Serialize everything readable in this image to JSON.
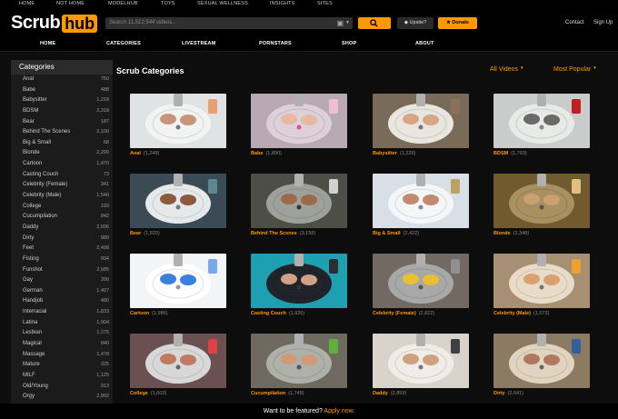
{
  "top_nav": [
    "HOME",
    "NOT HOME",
    "MODELHUB",
    "TOYS",
    "SEXUAL WELLNESS",
    "INSIGHTS",
    "SITES"
  ],
  "logo": {
    "part1": "Scrub",
    "part2": "hub"
  },
  "search": {
    "placeholder": "Search 11,512,544 videos..."
  },
  "header": {
    "upsell": "Upsite?",
    "donate": "Donate",
    "contact": "Contact",
    "signup": "Sign Up"
  },
  "main_nav": [
    "HOME",
    "CATEGORIES",
    "LIVESTREAM",
    "PORNSTARS",
    "SHOP",
    "ABOUT"
  ],
  "sidebar": {
    "title": "Categories",
    "items": [
      {
        "label": "Anal",
        "count": "750"
      },
      {
        "label": "Babe",
        "count": "488"
      },
      {
        "label": "Babysitter",
        "count": "1,218"
      },
      {
        "label": "BDSM",
        "count": "2,318"
      },
      {
        "label": "Bear",
        "count": "187"
      },
      {
        "label": "Behind The Scenes",
        "count": "2,100"
      },
      {
        "label": "Big & Small",
        "count": "68"
      },
      {
        "label": "Blonde",
        "count": "2,290"
      },
      {
        "label": "Cartoon",
        "count": "1,470"
      },
      {
        "label": "Casting Couch",
        "count": "73"
      },
      {
        "label": "Celebrity (Female)",
        "count": "341"
      },
      {
        "label": "Celebrity (Male)",
        "count": "1,540"
      },
      {
        "label": "College",
        "count": "193"
      },
      {
        "label": "Cucumpilation",
        "count": "842"
      },
      {
        "label": "Daddy",
        "count": "2,696"
      },
      {
        "label": "Dirty",
        "count": "989"
      },
      {
        "label": "Feet",
        "count": "2,498"
      },
      {
        "label": "Fisting",
        "count": "994"
      },
      {
        "label": "Funshot",
        "count": "2,685"
      },
      {
        "label": "Gay",
        "count": "390"
      },
      {
        "label": "German",
        "count": "1,407"
      },
      {
        "label": "Handjob",
        "count": "480"
      },
      {
        "label": "Interracial",
        "count": "1,833"
      },
      {
        "label": "Latina",
        "count": "1,904"
      },
      {
        "label": "Lesbian",
        "count": "1,275"
      },
      {
        "label": "Magical",
        "count": "840"
      },
      {
        "label": "Massage",
        "count": "1,478"
      },
      {
        "label": "Mature",
        "count": "325"
      },
      {
        "label": "MILF",
        "count": "1,125"
      },
      {
        "label": "Old/Young",
        "count": "913"
      },
      {
        "label": "Orgy",
        "count": "2,902"
      }
    ]
  },
  "main": {
    "title": "Scrub Categories",
    "filter_all": "All Videos",
    "filter_sort": "Most Popular",
    "tiles": [
      {
        "name": "Anal",
        "count": "(1,248)"
      },
      {
        "name": "Babe",
        "count": "(1,890)"
      },
      {
        "name": "Babysitter",
        "count": "(1,226)"
      },
      {
        "name": "BDSM",
        "count": "(1,793)"
      },
      {
        "name": "Bear",
        "count": "(1,920)"
      },
      {
        "name": "Behind The Scenes",
        "count": "(3,158)"
      },
      {
        "name": "Big & Small",
        "count": "(2,422)"
      },
      {
        "name": "Blonde",
        "count": "(2,348)"
      },
      {
        "name": "Cartoon",
        "count": "(1,986)"
      },
      {
        "name": "Casting Couch",
        "count": "(1,926)"
      },
      {
        "name": "Celebrity (Female)",
        "count": "(2,822)"
      },
      {
        "name": "Celebrity (Male)",
        "count": "(1,573)"
      },
      {
        "name": "College",
        "count": "(1,603)"
      },
      {
        "name": "Cucumpilation",
        "count": "(1,748)"
      },
      {
        "name": "Daddy",
        "count": "(2,859)"
      },
      {
        "name": "Dirty",
        "count": "(2,641)"
      }
    ]
  },
  "footer": {
    "question": "Want to be featured?",
    "action": "Apply now."
  },
  "colors": {
    "accent": "#ff9900",
    "background": "#000000",
    "panel": "#1b1b1b"
  },
  "icons": {
    "search": "search-icon",
    "camera": "camera-icon",
    "upsell": "diamond-icon",
    "donate": "star-icon"
  }
}
